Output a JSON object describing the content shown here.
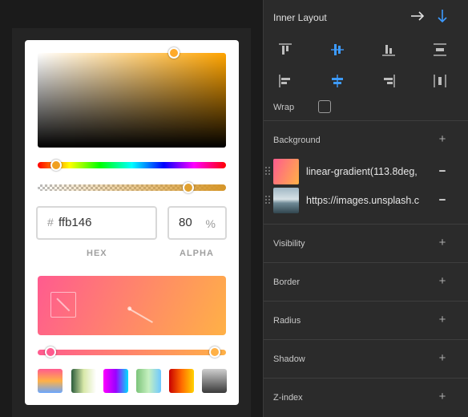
{
  "picker": {
    "hex_label": "HEX",
    "alpha_label": "ALPHA",
    "hash_symbol": "#",
    "hex_value": "ffb146",
    "alpha_value": "80",
    "percent_symbol": "%",
    "hue": 0.1,
    "alpha": 0.8,
    "saturation": 0.72,
    "brightness": 1.0,
    "gradient_stops": [
      {
        "position": 0.0,
        "color": "#ff5b8f"
      },
      {
        "position": 1.0,
        "color": "#ffb146"
      }
    ],
    "swatches": [
      {
        "name": "swatch-1",
        "gradient": "linear-gradient(to bottom, #ff5b8f, #ffb146, #6aa6ff)"
      },
      {
        "name": "swatch-2",
        "gradient": "linear-gradient(to right, #2a5b3a, #d8e8a8, #ffffff)"
      },
      {
        "name": "swatch-3",
        "gradient": "linear-gradient(to right, #ff00ff, #9b00ff, #00e0ff)"
      },
      {
        "name": "swatch-4",
        "gradient": "linear-gradient(to right, #7cc47a, #c6f0c0, #6ec8ff)"
      },
      {
        "name": "swatch-5",
        "gradient": "linear-gradient(to right, #c80000, #ff6a00, #ffd200)"
      },
      {
        "name": "swatch-6",
        "gradient": "linear-gradient(to bottom, #cfcfcf, #3a3a3a)"
      }
    ]
  },
  "panel": {
    "title": "Inner Layout",
    "wrap_label": "Wrap",
    "sections": [
      {
        "key": "background",
        "label": "Background"
      },
      {
        "key": "visibility",
        "label": "Visibility"
      },
      {
        "key": "border",
        "label": "Border"
      },
      {
        "key": "radius",
        "label": "Radius"
      },
      {
        "key": "shadow",
        "label": "Shadow"
      },
      {
        "key": "zindex",
        "label": "Z-index"
      }
    ],
    "background_layers": [
      {
        "text": "linear-gradient(113.8deg,"
      },
      {
        "text": "https://images.unsplash.c"
      }
    ],
    "plus_symbol": "+",
    "minus_symbol": "−"
  },
  "colors": {
    "accent": "#3d9bff",
    "gradient_start": "#ff5b8f",
    "gradient_end": "#ffb146"
  },
  "icons": {
    "direction_row": "arrow-right-icon",
    "direction_column": "arrow-down-icon"
  }
}
